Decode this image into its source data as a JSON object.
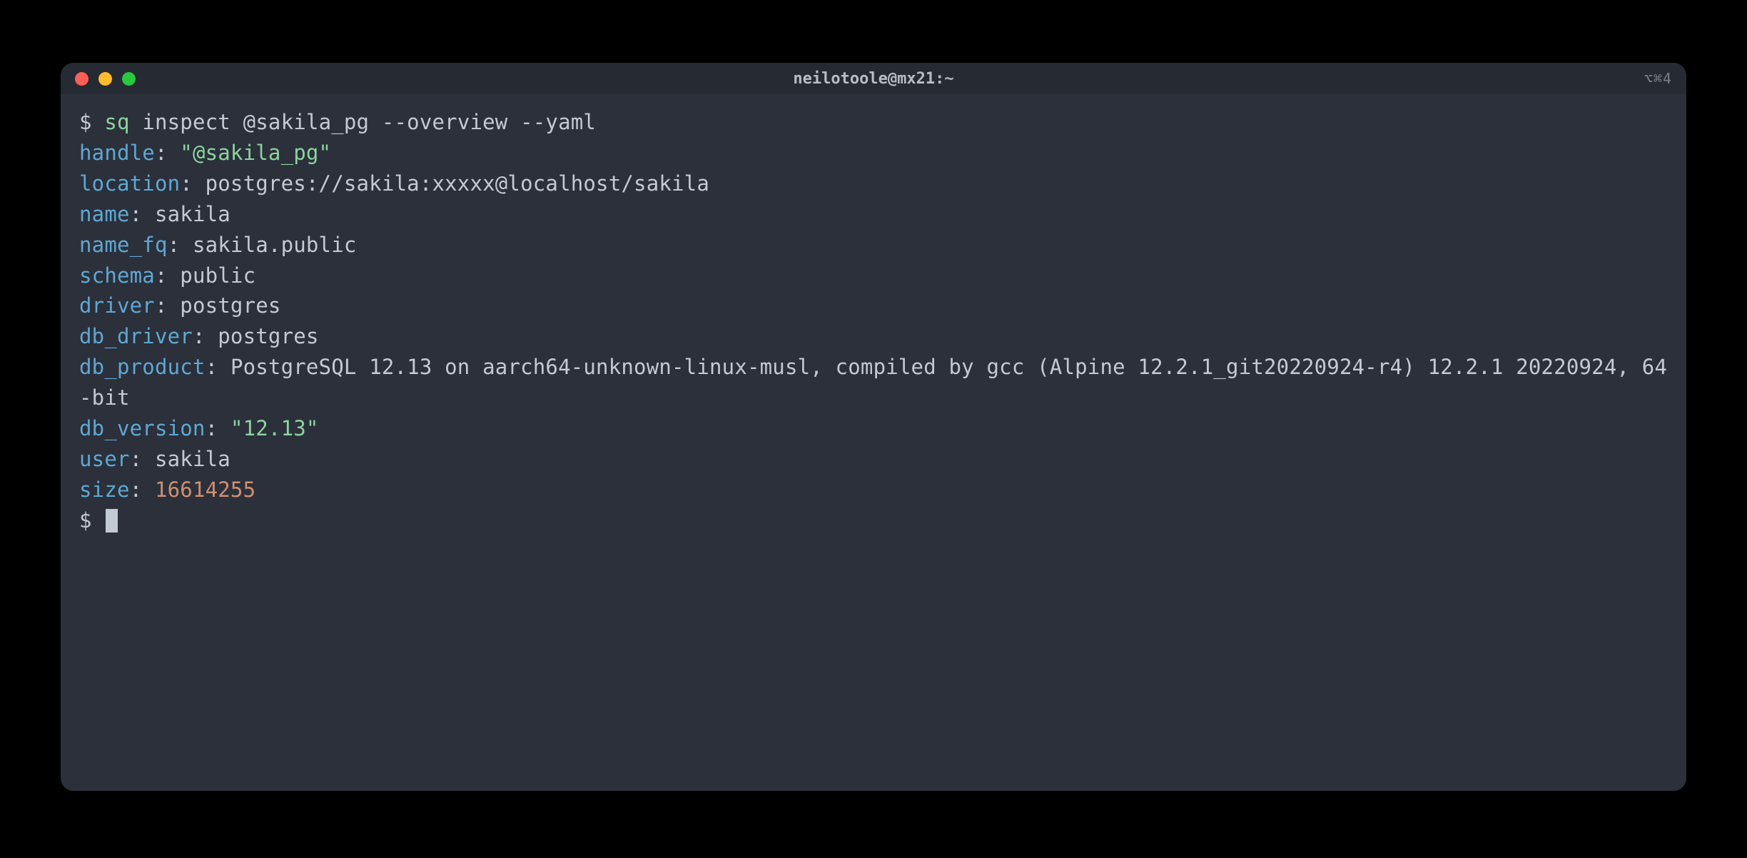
{
  "window": {
    "title": "neilotoole@mx21:~",
    "right_info": "⌥⌘4"
  },
  "prompt": {
    "symbol": "$",
    "command_name": "sq",
    "command_rest": " inspect @sakila_pg --overview --yaml"
  },
  "output": {
    "handle": {
      "key": "handle",
      "value": "\"@sakila_pg\""
    },
    "location": {
      "key": "location",
      "value": "postgres://sakila:xxxxx@localhost/sakila"
    },
    "name": {
      "key": "name",
      "value": "sakila"
    },
    "name_fq": {
      "key": "name_fq",
      "value": "sakila.public"
    },
    "schema": {
      "key": "schema",
      "value": "public"
    },
    "driver": {
      "key": "driver",
      "value": "postgres"
    },
    "db_driver": {
      "key": "db_driver",
      "value": "postgres"
    },
    "db_product": {
      "key": "db_product",
      "value": "PostgreSQL 12.13 on aarch64-unknown-linux-musl, compiled by gcc (Alpine 12.2.1_git20220924-r4) 12.2.1 20220924, 64-bit"
    },
    "db_version": {
      "key": "db_version",
      "value": "\"12.13\""
    },
    "user": {
      "key": "user",
      "value": "sakila"
    },
    "size": {
      "key": "size",
      "value": "16614255"
    }
  },
  "colon": ": "
}
